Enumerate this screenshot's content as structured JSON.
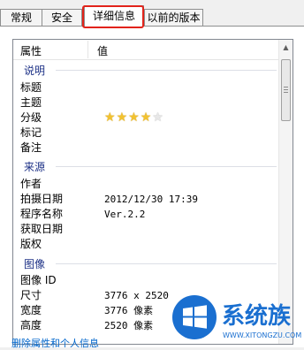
{
  "tabs": [
    "常规",
    "安全",
    "详细信息",
    "以前的版本"
  ],
  "columns": {
    "property": "属性",
    "value": "值"
  },
  "groups": [
    {
      "title": "说明",
      "rows": [
        {
          "name": "标题",
          "value": ""
        },
        {
          "name": "主题",
          "value": ""
        },
        {
          "name": "分级",
          "value": "",
          "rating": 4,
          "rating_max": 5
        },
        {
          "name": "标记",
          "value": ""
        },
        {
          "name": "备注",
          "value": ""
        }
      ]
    },
    {
      "title": "来源",
      "rows": [
        {
          "name": "作者",
          "value": ""
        },
        {
          "name": "拍摄日期",
          "value": "2012/12/30 17:39"
        },
        {
          "name": "程序名称",
          "value": "Ver.2.2"
        },
        {
          "name": "获取日期",
          "value": ""
        },
        {
          "name": "版权",
          "value": ""
        }
      ]
    },
    {
      "title": "图像",
      "rows": [
        {
          "name": "图像 ID",
          "value": ""
        },
        {
          "name": "尺寸",
          "value": "3776 x 2520"
        },
        {
          "name": "宽度",
          "value": "3776 像素"
        },
        {
          "name": "高度",
          "value": "2520 像素"
        }
      ]
    }
  ],
  "footer_link": "删除属性和个人信息",
  "watermark": {
    "brand": "系统族",
    "url": "WWW.XITONGZU.COM"
  },
  "colors": {
    "tab_highlight": "#e2231a",
    "group_heading": "#1e3287",
    "link": "#0066cc",
    "logo_blue": "#1a6fd0",
    "star_on": "#f2c230"
  }
}
